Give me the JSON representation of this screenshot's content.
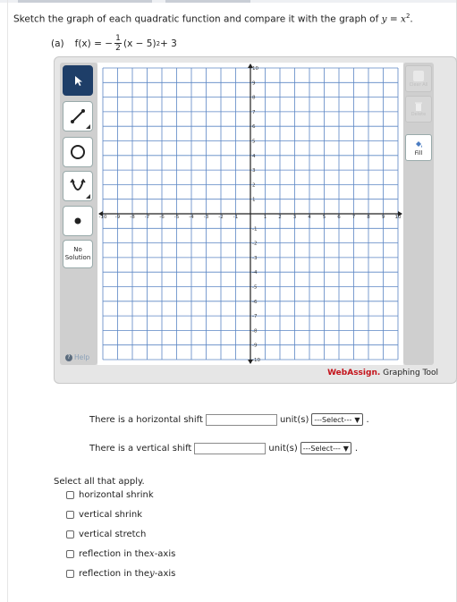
{
  "instruction": {
    "prefix": "Sketch the graph of each quadratic function and compare it with the graph of ",
    "fx": "y",
    "eq": " = ",
    "xvar": "x",
    "exp": "2",
    "end": "."
  },
  "part": {
    "label": "(a)",
    "lhs": "f(x) = −",
    "frac_num": "1",
    "frac_den": "2",
    "rhs": "(x − 5)",
    "rhs_exp": "2",
    "rhs_tail": " + 3"
  },
  "tool": {
    "no_solution_line1": "No",
    "no_solution_line2": "Solution",
    "help_label": "Help",
    "clear_all_label": "Clear All",
    "delete_label": "Delete",
    "fill_label": "Fill",
    "brand_name": "WebAssign.",
    "brand_suffix": " Graphing Tool",
    "accent": "#1e3e68",
    "brand_color": "#c4121a"
  },
  "graph": {
    "xmin": -10,
    "xmax": 10,
    "ymin": -10,
    "ymax": 10,
    "x_ticks": [
      "-10",
      "-9",
      "-8",
      "-7",
      "-6",
      "-5",
      "-4",
      "-3",
      "-2",
      "-1",
      "1",
      "2",
      "3",
      "4",
      "5",
      "6",
      "7",
      "8",
      "9",
      "10"
    ],
    "y_ticks": [
      "10",
      "9",
      "8",
      "7",
      "6",
      "5",
      "4",
      "3",
      "2",
      "1",
      "-1",
      "-2",
      "-3",
      "-4",
      "-5",
      "-6",
      "-7",
      "-8",
      "-9",
      "-10"
    ],
    "grid_color": "#5b86c4",
    "axis_color": "#222222"
  },
  "questions": {
    "horizontal_prefix": "There is a horizontal shift",
    "vertical_prefix": "There is a vertical shift",
    "unit_label": "unit(s)",
    "select_placeholder": "---Select---"
  },
  "select_all": {
    "heading": "Select all that apply.",
    "options": [
      {
        "label": "horizontal shrink"
      },
      {
        "label": "vertical shrink"
      },
      {
        "label": "vertical stretch"
      },
      {
        "label": "reflection in the ",
        "var": "x",
        "suffix": "-axis"
      },
      {
        "label": "reflection in the ",
        "var": "y",
        "suffix": "-axis"
      }
    ]
  }
}
